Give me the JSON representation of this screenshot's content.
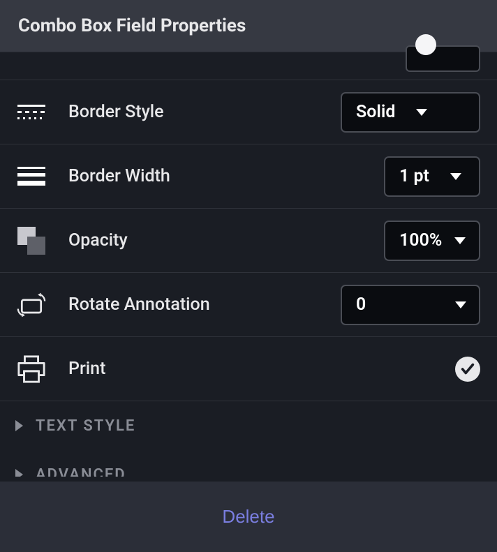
{
  "header": {
    "title": "Combo Box Field Properties"
  },
  "rows": {
    "border_style": {
      "label": "Border Style",
      "value": "Solid"
    },
    "border_width": {
      "label": "Border Width",
      "value": "1 pt"
    },
    "opacity": {
      "label": "Opacity",
      "value": "100%"
    },
    "rotate": {
      "label": "Rotate Annotation",
      "value": "0"
    },
    "print": {
      "label": "Print",
      "checked": true
    }
  },
  "sections": {
    "text_style": {
      "title": "TEXT STYLE"
    },
    "advanced": {
      "title": "ADVANCED"
    }
  },
  "footer": {
    "delete_label": "Delete"
  }
}
